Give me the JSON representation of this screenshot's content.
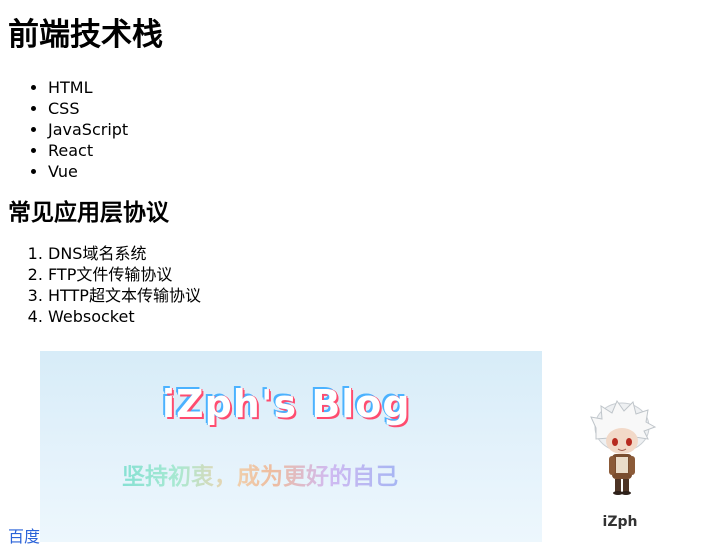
{
  "heading1": "前端技术栈",
  "tech_stack": [
    "HTML",
    "CSS",
    "JavaScript",
    "React",
    "Vue"
  ],
  "heading2": "常见应用层协议",
  "protocols": [
    "DNS域名系统",
    "FTP文件传输协议",
    "HTTP超文本传输协议",
    "Websocket"
  ],
  "link": {
    "label": "百度",
    "color": "#2b63d9"
  },
  "banner": {
    "title": "iZph's Blog",
    "subtitle": "坚持初衷，成为更好的自己"
  },
  "profile": {
    "name": "iZph"
  }
}
